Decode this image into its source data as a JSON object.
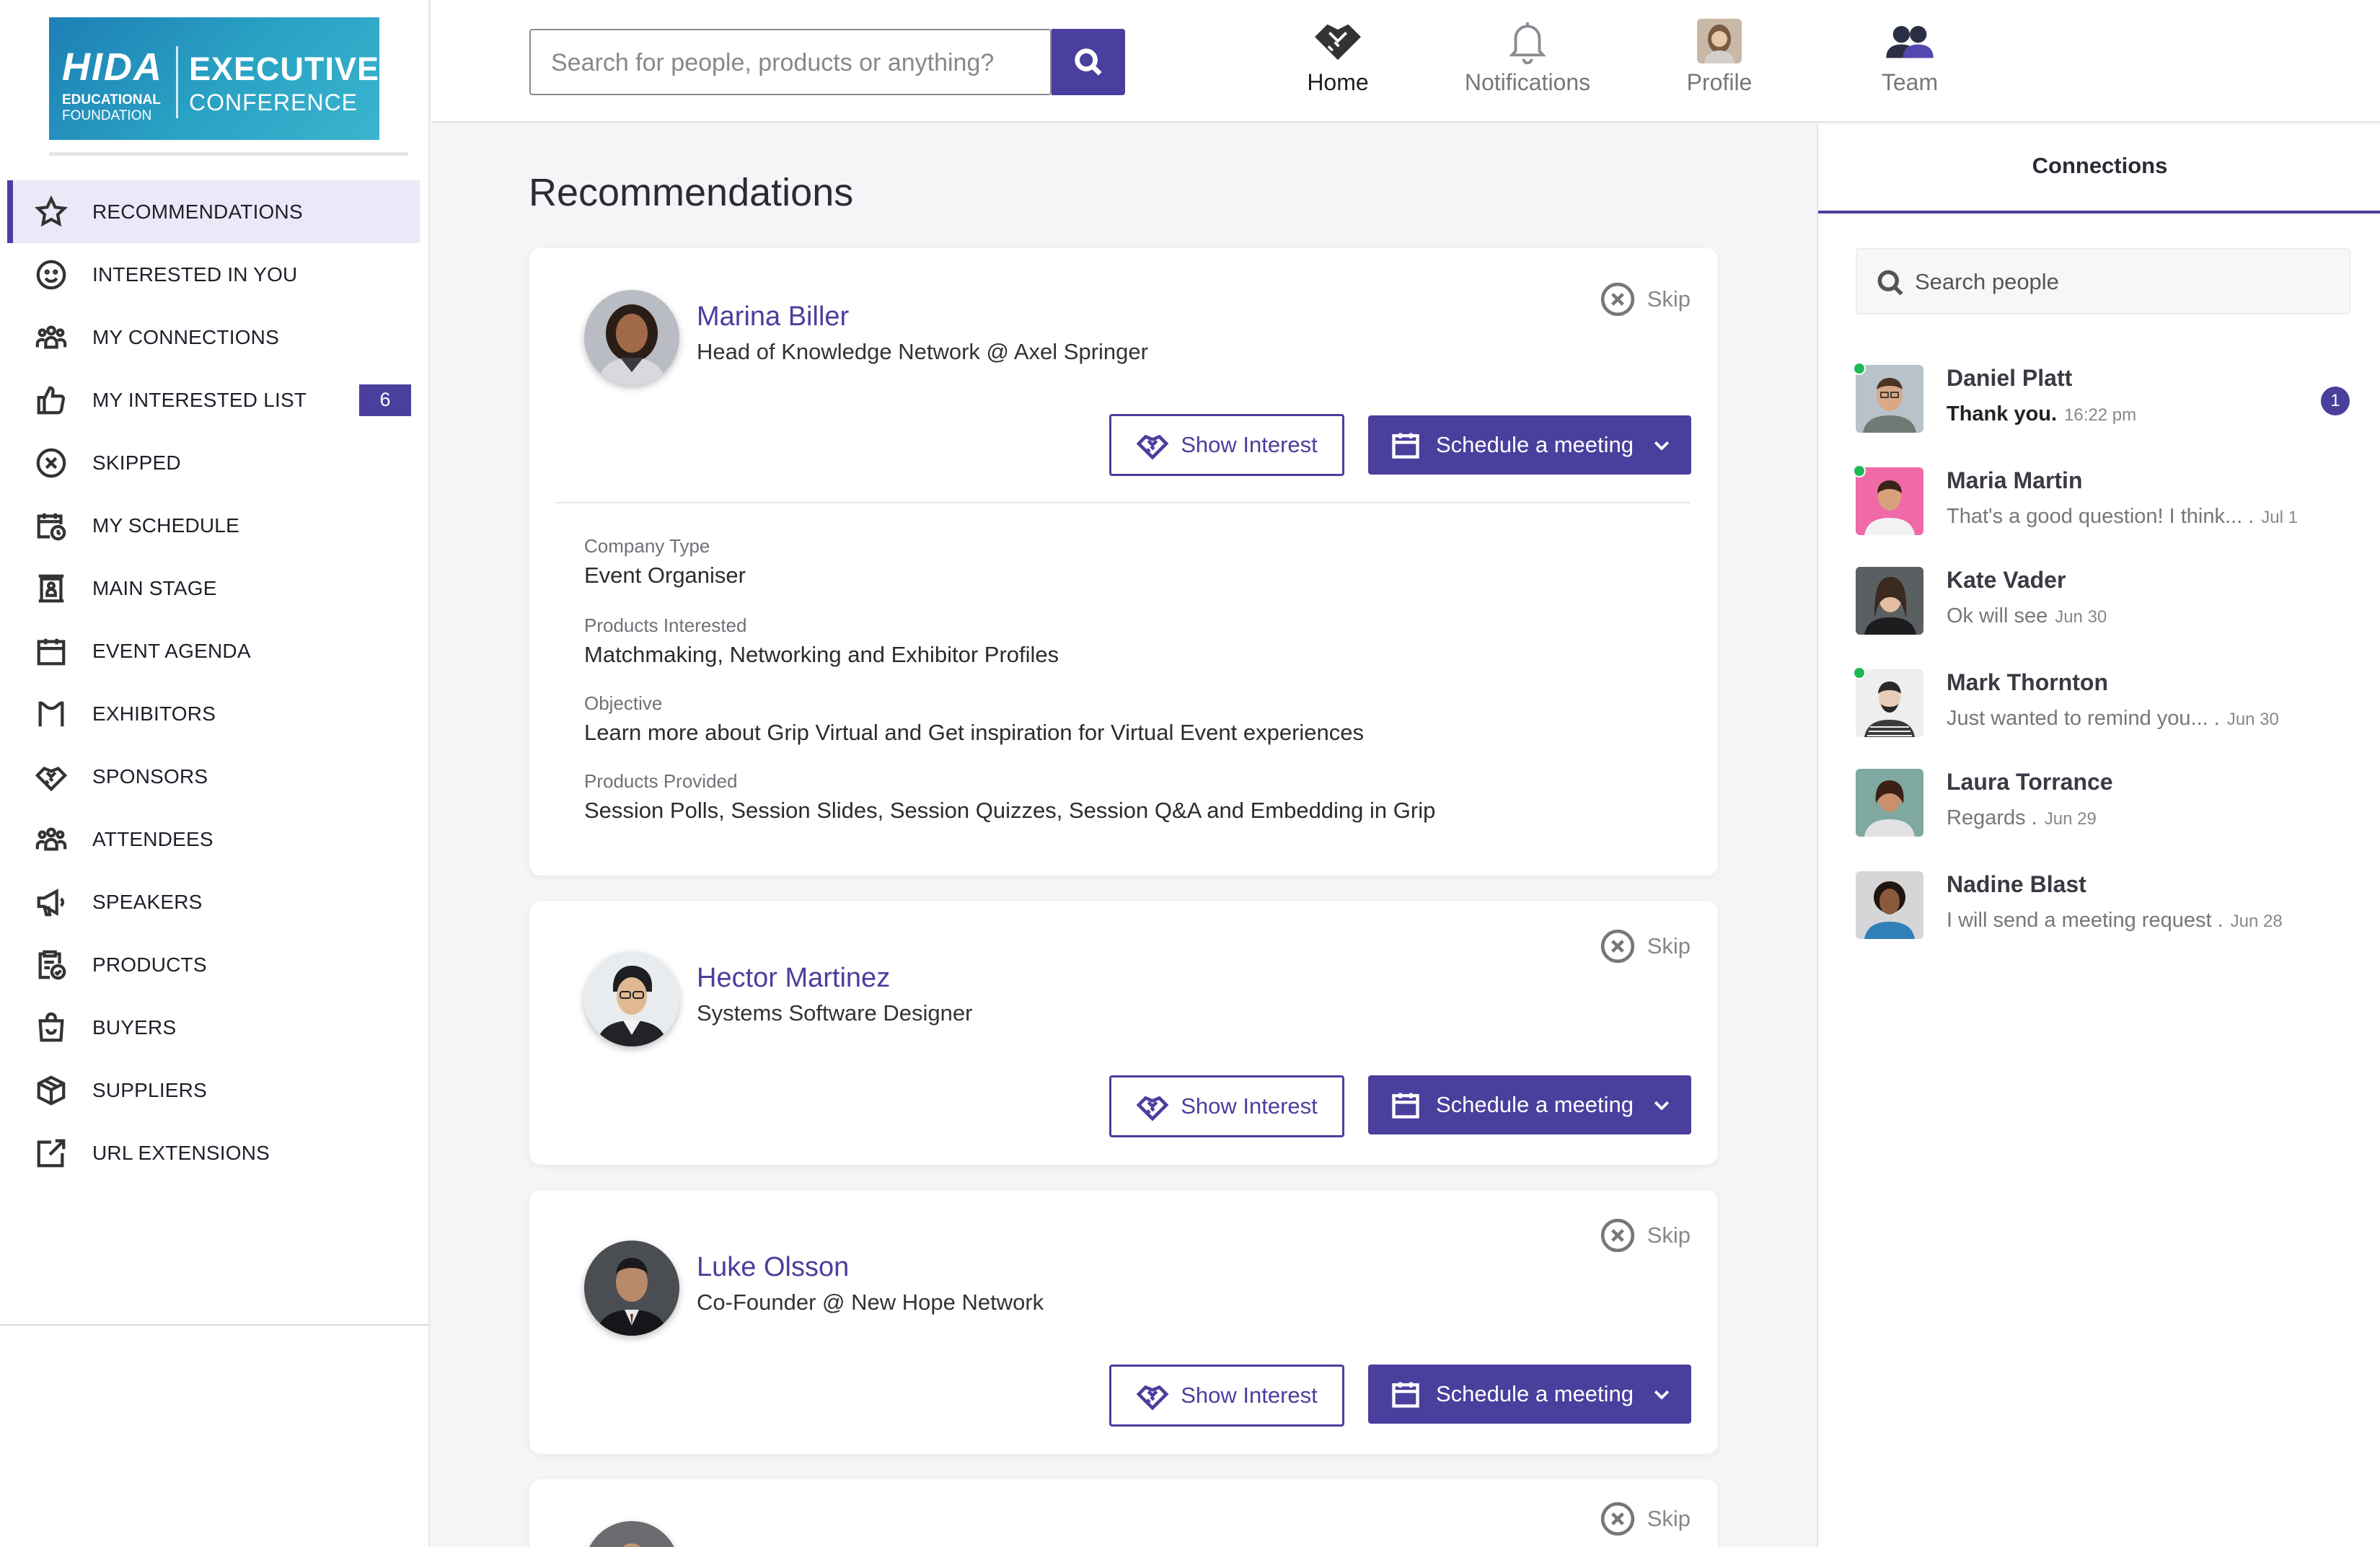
{
  "logo": {
    "brand": "HIDA",
    "foundation_line1": "EDUCATIONAL",
    "foundation_line2": "FOUNDATION",
    "event_line1": "EXECUTIVE",
    "event_line2": "CONFERENCE"
  },
  "sidebar": {
    "items": [
      {
        "label": "RECOMMENDATIONS",
        "icon": "star-icon",
        "active": true
      },
      {
        "label": "INTERESTED IN YOU",
        "icon": "smiley-icon"
      },
      {
        "label": "MY CONNECTIONS",
        "icon": "group-icon"
      },
      {
        "label": "MY INTERESTED LIST",
        "icon": "thumbs-up-icon",
        "badge": "6"
      },
      {
        "label": "SKIPPED",
        "icon": "x-circle-icon"
      },
      {
        "label": "MY SCHEDULE",
        "icon": "calendar-clock-icon"
      },
      {
        "label": "MAIN STAGE",
        "icon": "stage-icon"
      },
      {
        "label": "EVENT AGENDA",
        "icon": "calendar-icon"
      },
      {
        "label": "EXHIBITORS",
        "icon": "booth-icon"
      },
      {
        "label": "SPONSORS",
        "icon": "handshake-icon"
      },
      {
        "label": "ATTENDEES",
        "icon": "group-icon"
      },
      {
        "label": "SPEAKERS",
        "icon": "megaphone-icon"
      },
      {
        "label": "PRODUCTS",
        "icon": "clipboard-check-icon"
      },
      {
        "label": "BUYERS",
        "icon": "shopping-bag-icon"
      },
      {
        "label": "SUPPLIERS",
        "icon": "box-icon"
      },
      {
        "label": "URL EXTENSIONS",
        "icon": "external-link-icon"
      }
    ]
  },
  "header": {
    "search_placeholder": "Search for people, products or anything?",
    "nav": [
      {
        "label": "Home",
        "icon": "handshake-icon",
        "active": true
      },
      {
        "label": "Notifications",
        "icon": "bell-icon"
      },
      {
        "label": "Profile",
        "icon": "profile-avatar"
      },
      {
        "label": "Team",
        "icon": "team-icon"
      }
    ]
  },
  "main": {
    "title": "Recommendations",
    "skip_label": "Skip",
    "show_interest_label": "Show Interest",
    "schedule_label": "Schedule a meeting",
    "cards": [
      {
        "name": "Marina Biller",
        "title": "Head of Knowledge Network @ Axel Springer",
        "details": [
          {
            "label": "Company Type",
            "value": "Event Organiser"
          },
          {
            "label": "Products Interested",
            "value": "Matchmaking, Networking and Exhibitor Profiles"
          },
          {
            "label": "Objective",
            "value": "Learn more about Grip Virtual and Get inspiration for Virtual Event experiences"
          },
          {
            "label": "Products Provided",
            "value": "Session Polls, Session Slides, Session Quizzes, Session Q&A and Embedding in Grip"
          }
        ]
      },
      {
        "name": "Hector Martinez",
        "title": "Systems Software Designer"
      },
      {
        "name": "Luke Olsson",
        "title": "Co-Founder  @ New Hope Network"
      }
    ]
  },
  "connections": {
    "tab_label": "Connections",
    "search_placeholder": "Search people",
    "conversations": [
      {
        "name": "Daniel Platt",
        "message": "Thank you.",
        "time": "16:22 pm",
        "unread": "1",
        "online": true
      },
      {
        "name": "Maria Martin",
        "message": "That's a good question! I think... .",
        "time": "Jul 1",
        "online": true
      },
      {
        "name": "Kate Vader",
        "message": "Ok will see",
        "time": "Jun 30",
        "online": false
      },
      {
        "name": "Mark Thornton",
        "message": "Just wanted to remind you... .",
        "time": "Jun 30",
        "online": true
      },
      {
        "name": "Laura Torrance",
        "message": "Regards .",
        "time": "Jun 29",
        "online": false
      },
      {
        "name": "Nadine Blast",
        "message": "I will send a meeting request .",
        "time": "Jun 28",
        "online": false
      }
    ]
  },
  "colors": {
    "accent": "#4a3f9d",
    "online": "#1db954",
    "logo_bg": "#2496bf"
  }
}
